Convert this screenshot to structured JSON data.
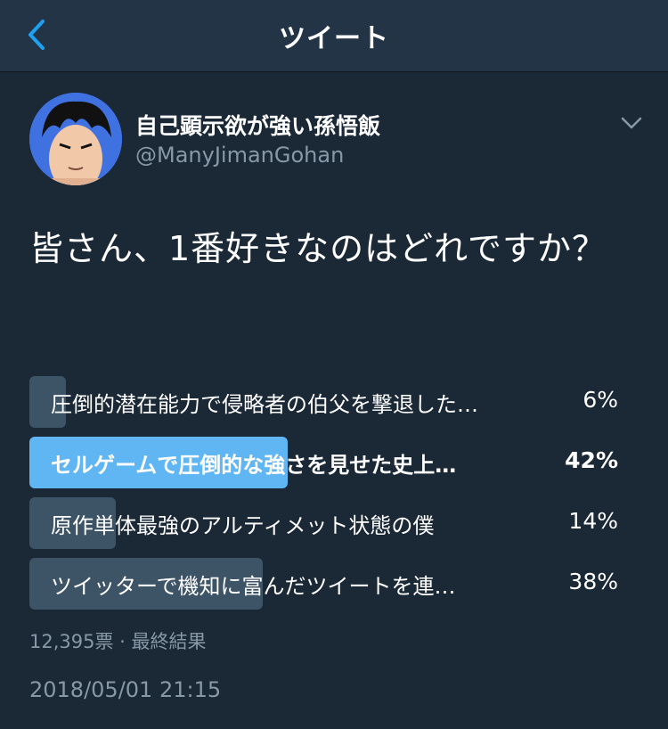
{
  "header": {
    "title": "ツイート",
    "back_icon": "chevron-left-icon",
    "accent": "#1da1f2"
  },
  "tweet": {
    "author_name": "自己顕示欲が強い孫悟飯",
    "author_handle": "@ManyJimanGohan",
    "avatar_icon": "avatar-image",
    "menu_icon": "chevron-down-icon",
    "text": "皆さん、1番好きなのはどれですか？"
  },
  "poll": {
    "options": [
      {
        "label": "圧倒的潜在能力で侵略者の伯父を撃退した…",
        "percent": "6%",
        "fraction": 0.06,
        "winner": false
      },
      {
        "label": "セルゲームで圧倒的な強さを見せた史上…",
        "percent": "42%",
        "fraction": 0.42,
        "winner": true
      },
      {
        "label": "原作単体最強のアルティメット状態の僕",
        "percent": "14%",
        "fraction": 0.14,
        "winner": false
      },
      {
        "label": "ツイッターで機知に富んだツイートを連…",
        "percent": "38%",
        "fraction": 0.38,
        "winner": false
      }
    ],
    "summary": "12,395票 · 最終結果",
    "bar_color": "#3d5366",
    "winner_color": "#60b6f2"
  },
  "timestamp": "2018/05/01 21:15"
}
